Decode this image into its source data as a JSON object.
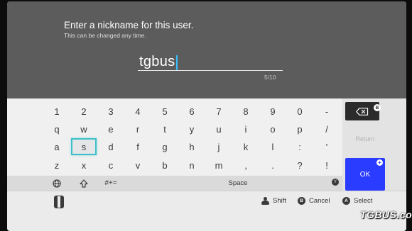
{
  "prompt": {
    "title": "Enter a nickname for this user.",
    "subtitle": "This can be changed any time."
  },
  "input": {
    "value": "tgbus",
    "counter": "5/10"
  },
  "keyboard": {
    "rows": [
      [
        "1",
        "2",
        "3",
        "4",
        "5",
        "6",
        "7",
        "8",
        "9",
        "0",
        "-"
      ],
      [
        "q",
        "w",
        "e",
        "r",
        "t",
        "y",
        "u",
        "i",
        "o",
        "p",
        "/"
      ],
      [
        "a",
        "s",
        "d",
        "f",
        "g",
        "h",
        "j",
        "k",
        "l",
        ":",
        "'"
      ],
      [
        "z",
        "x",
        "c",
        "v",
        "b",
        "n",
        "m",
        ",",
        ".",
        "?",
        "!"
      ]
    ],
    "selected_key": "s",
    "symbols_label": "#+=",
    "space_label": "Space",
    "space_badge": "Y",
    "backspace_badge": "B",
    "return_label": "Return",
    "ok_label": "OK",
    "ok_badge": "+"
  },
  "footer": {
    "shift": "Shift",
    "cancel_badge": "B",
    "cancel": "Cancel",
    "select_badge": "A",
    "select": "Select"
  },
  "watermark": "TGBUS.com",
  "colors": {
    "selection_outline": "#3cc0c9",
    "caret": "#38c0ff",
    "ok_button": "#2a3cff"
  }
}
